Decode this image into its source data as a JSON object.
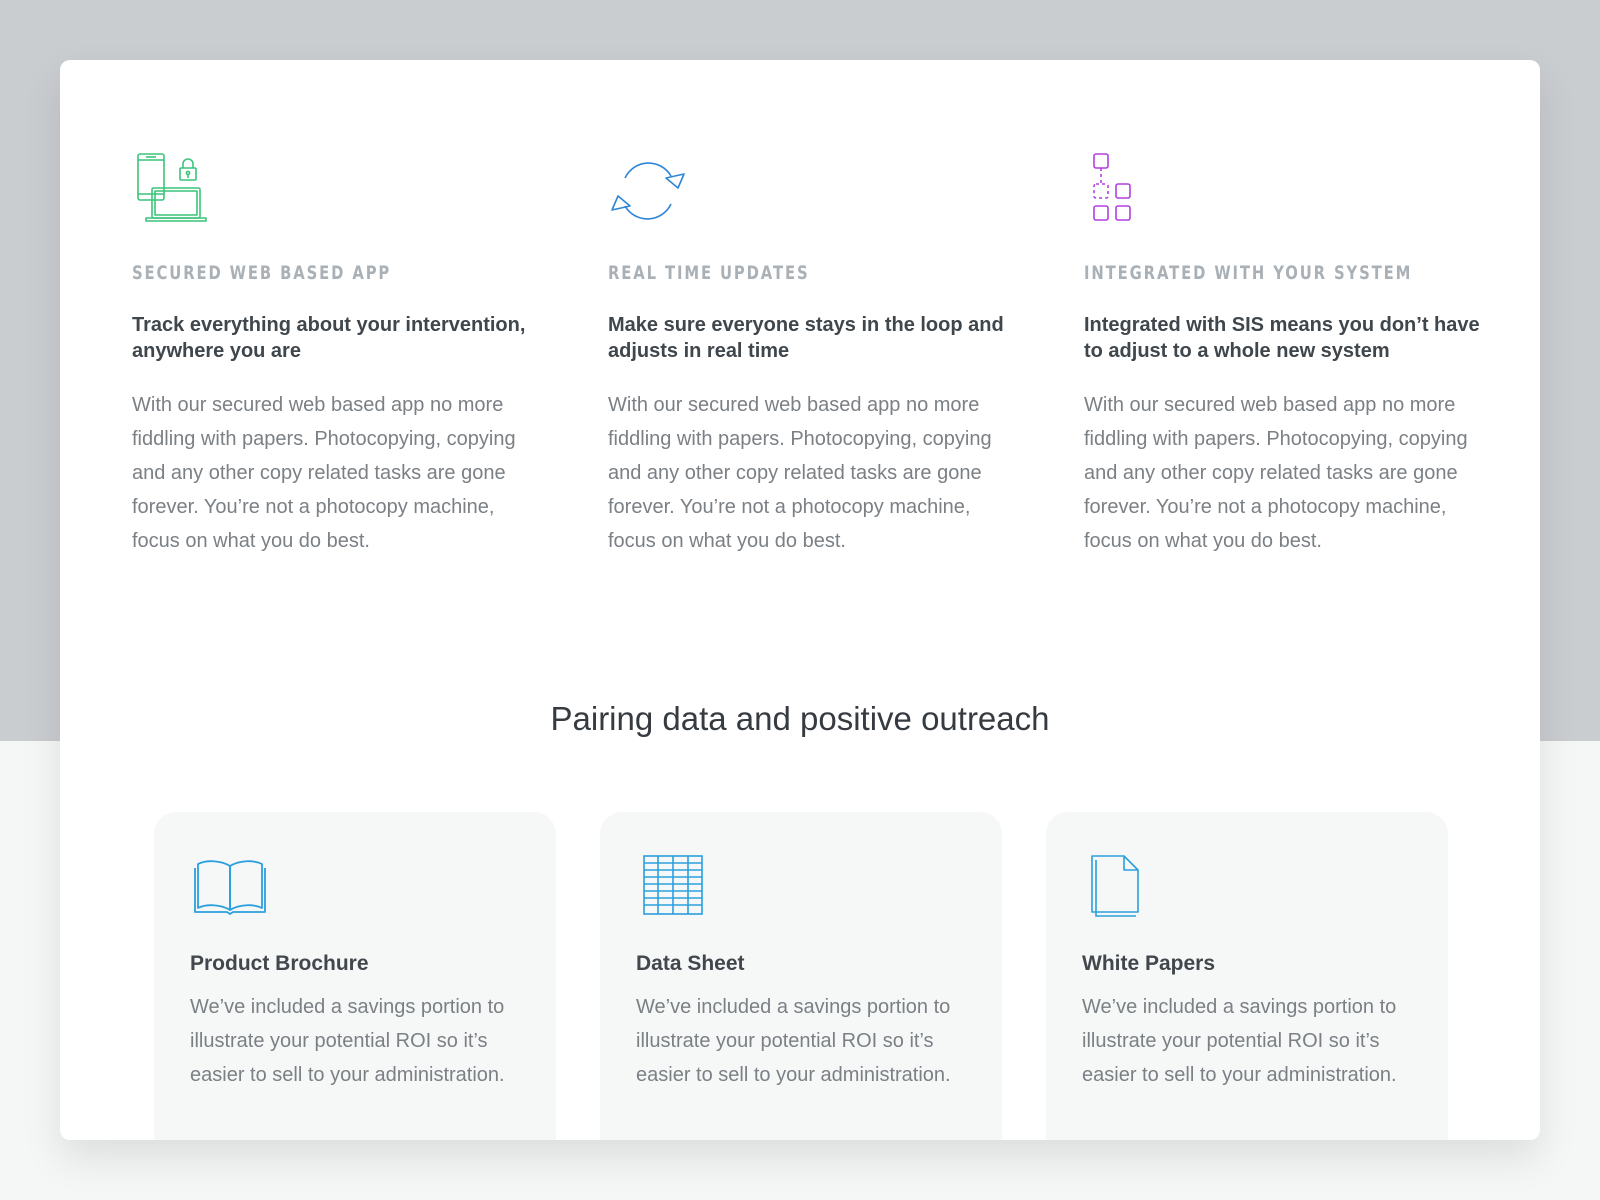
{
  "features": [
    {
      "icon": "devices-lock-icon",
      "eyebrow": "SECURED WEB BASED APP",
      "subtitle": "Track everything about your intervention, anywhere you are",
      "body": "With our secured web based app no more fiddling with papers. Photocopying, copying and any other copy related tasks are gone forever. You’re not a photocopy machine, focus on what you do best."
    },
    {
      "icon": "sync-arrows-icon",
      "eyebrow": "REAL TIME UPDATES",
      "subtitle": "Make sure everyone stays in the loop and adjusts in real time",
      "body": "With our secured web based app no more fiddling with papers. Photocopying, copying and any other copy related tasks are gone forever. You’re not a photocopy machine, focus on what you do best."
    },
    {
      "icon": "integration-blocks-icon",
      "eyebrow": "INTEGRATED WITH YOUR SYSTEM",
      "subtitle": "Integrated with SIS means you don’t have to adjust to a whole new system",
      "body": "With our secured web based app no more fiddling with papers. Photocopying, copying and any other copy related tasks are gone forever. You’re not a photocopy machine, focus on what you do best."
    }
  ],
  "section": {
    "title": "Pairing data and positive outreach"
  },
  "resources": [
    {
      "icon": "open-book-icon",
      "title": "Product Brochure",
      "body": "We’ve included a savings portion to illustrate your potential ROI so it’s easier to sell to your administration."
    },
    {
      "icon": "spreadsheet-icon",
      "title": "Data Sheet",
      "body": "We’ve included a savings portion to illustrate your potential ROI so it’s easier to sell to your administration."
    },
    {
      "icon": "document-stack-icon",
      "title": "White Papers",
      "body": "We’ve included a savings portion to illustrate your potential ROI so it’s easier to sell to your administration."
    }
  ],
  "colors": {
    "green": "#3cc47a",
    "blue": "#2f86d6",
    "purple": "#b23fe0",
    "resource_icon": "#2a9fde",
    "background_top": "#cacdd0"
  }
}
